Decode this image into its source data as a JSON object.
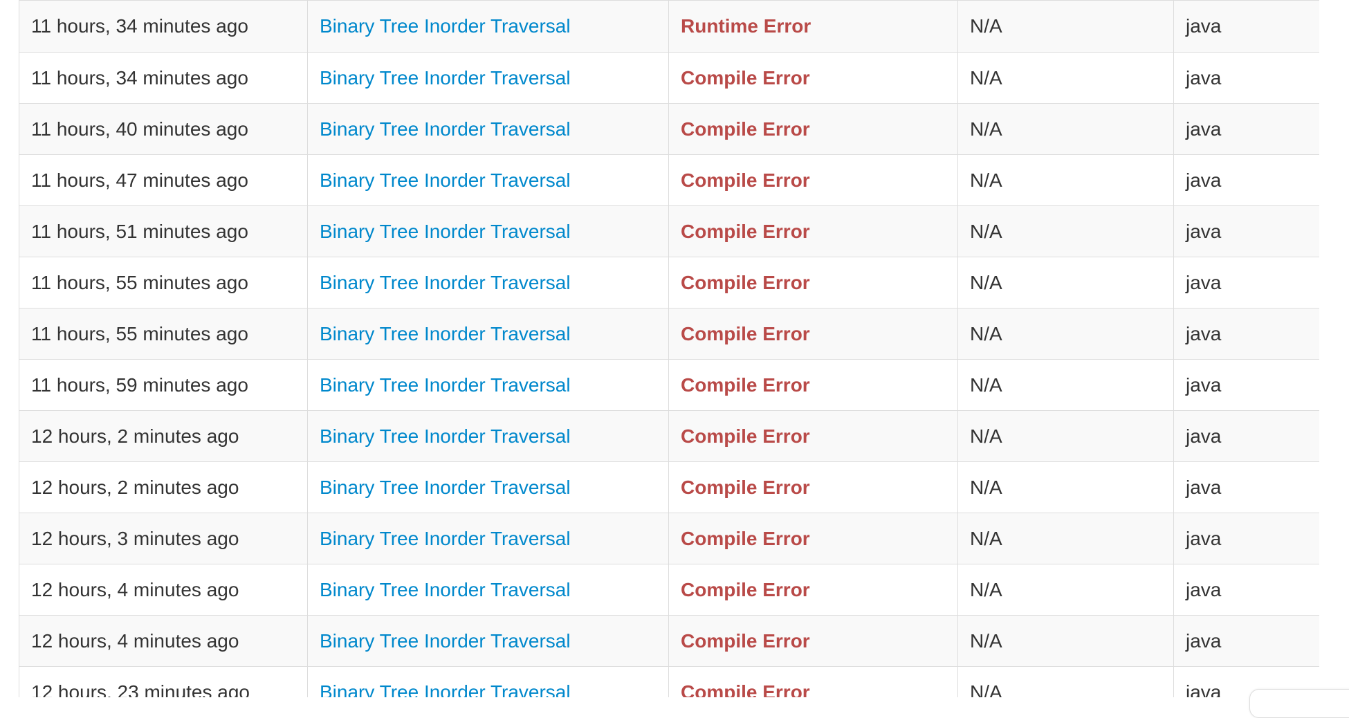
{
  "colors": {
    "link": "#0088cc",
    "error_status": "#b94a48",
    "row_odd": "#f9f9f9",
    "row_even": "#ffffff",
    "border": "#dddddd",
    "text": "#333333"
  },
  "submissions": {
    "rows": [
      {
        "time": "11 hours, 34 minutes ago",
        "question": "Binary Tree Inorder Traversal",
        "status": "Runtime Error",
        "runtime": "N/A",
        "language": "java"
      },
      {
        "time": "11 hours, 34 minutes ago",
        "question": "Binary Tree Inorder Traversal",
        "status": "Compile Error",
        "runtime": "N/A",
        "language": "java"
      },
      {
        "time": "11 hours, 40 minutes ago",
        "question": "Binary Tree Inorder Traversal",
        "status": "Compile Error",
        "runtime": "N/A",
        "language": "java"
      },
      {
        "time": "11 hours, 47 minutes ago",
        "question": "Binary Tree Inorder Traversal",
        "status": "Compile Error",
        "runtime": "N/A",
        "language": "java"
      },
      {
        "time": "11 hours, 51 minutes ago",
        "question": "Binary Tree Inorder Traversal",
        "status": "Compile Error",
        "runtime": "N/A",
        "language": "java"
      },
      {
        "time": "11 hours, 55 minutes ago",
        "question": "Binary Tree Inorder Traversal",
        "status": "Compile Error",
        "runtime": "N/A",
        "language": "java"
      },
      {
        "time": "11 hours, 55 minutes ago",
        "question": "Binary Tree Inorder Traversal",
        "status": "Compile Error",
        "runtime": "N/A",
        "language": "java"
      },
      {
        "time": "11 hours, 59 minutes ago",
        "question": "Binary Tree Inorder Traversal",
        "status": "Compile Error",
        "runtime": "N/A",
        "language": "java"
      },
      {
        "time": "12 hours, 2 minutes ago",
        "question": "Binary Tree Inorder Traversal",
        "status": "Compile Error",
        "runtime": "N/A",
        "language": "java"
      },
      {
        "time": "12 hours, 2 minutes ago",
        "question": "Binary Tree Inorder Traversal",
        "status": "Compile Error",
        "runtime": "N/A",
        "language": "java"
      },
      {
        "time": "12 hours, 3 minutes ago",
        "question": "Binary Tree Inorder Traversal",
        "status": "Compile Error",
        "runtime": "N/A",
        "language": "java"
      },
      {
        "time": "12 hours, 4 minutes ago",
        "question": "Binary Tree Inorder Traversal",
        "status": "Compile Error",
        "runtime": "N/A",
        "language": "java"
      },
      {
        "time": "12 hours, 4 minutes ago",
        "question": "Binary Tree Inorder Traversal",
        "status": "Compile Error",
        "runtime": "N/A",
        "language": "java"
      },
      {
        "time": "12 hours, 23 minutes ago",
        "question": "Binary Tree Inorder Traversal",
        "status": "Compile Error",
        "runtime": "N/A",
        "language": "java"
      }
    ]
  }
}
